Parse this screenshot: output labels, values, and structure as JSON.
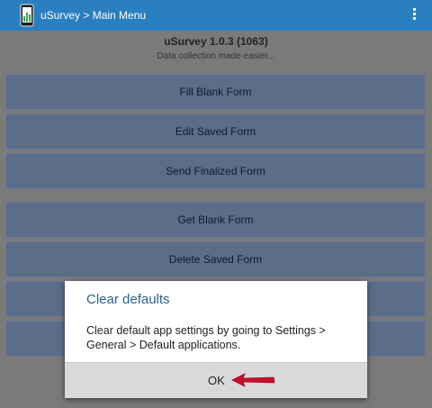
{
  "actionbar": {
    "title": "uSurvey > Main Menu",
    "app_icon": "phone-chart-icon",
    "overflow_icon": "overflow-menu-icon",
    "color": "#2a7fc0"
  },
  "header": {
    "title": "uSurvey 1.0.3 (1063)",
    "subtitle": "Data collection made easier..."
  },
  "menu": {
    "fill_blank": "Fill Blank Form",
    "edit_saved": "Edit Saved Form",
    "send_finalized": "Send Finalized Form",
    "get_blank": "Get Blank Form",
    "delete_saved": "Delete Saved Form"
  },
  "dialog": {
    "title": "Clear defaults",
    "message": "Clear default app settings by going to Settings > General > Default applications.",
    "ok_label": "OK",
    "arrow_icon": "red-arrow-icon"
  }
}
